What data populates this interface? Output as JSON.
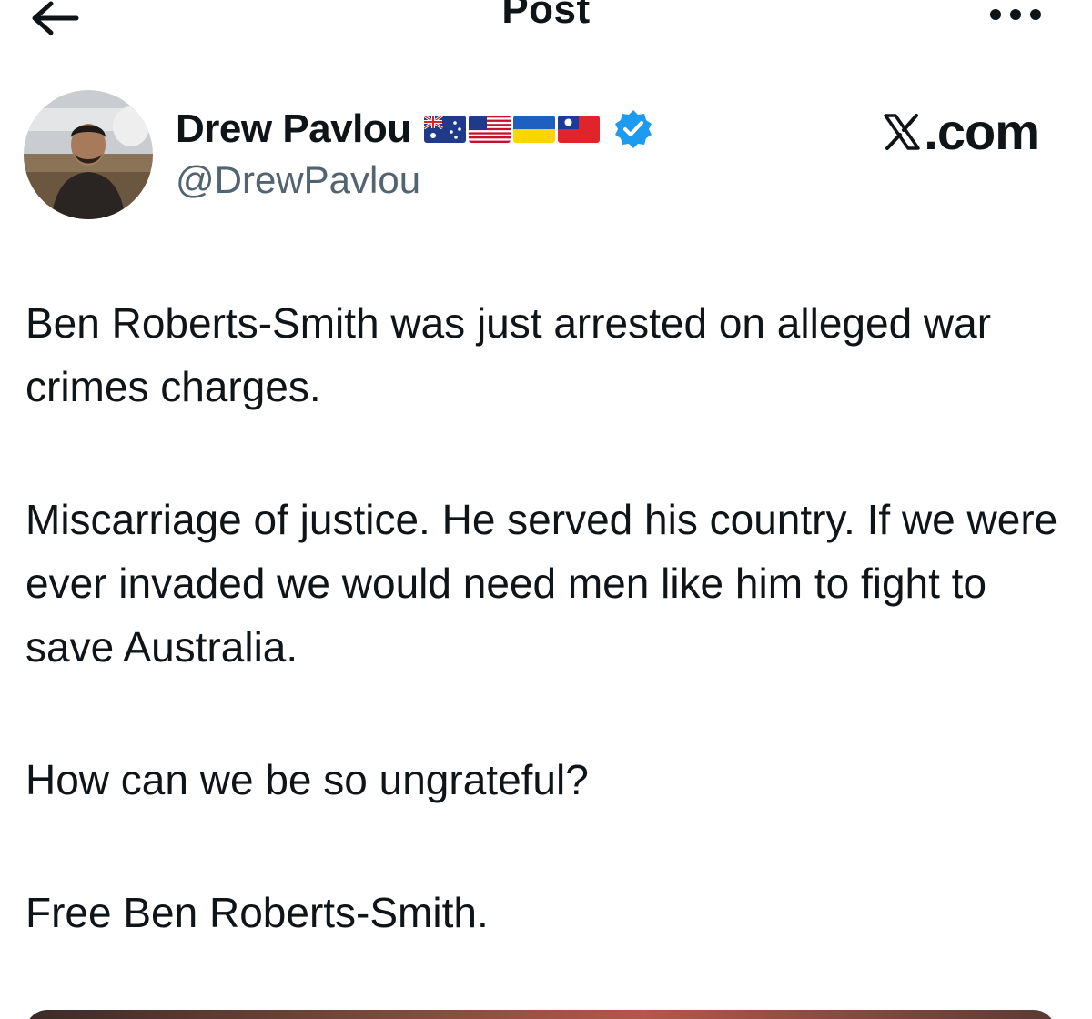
{
  "header": {
    "title": "Post"
  },
  "author": {
    "name": "Drew Pavlou",
    "handle": "@DrewPavlou",
    "flags": [
      "australia-flag",
      "usa-flag",
      "ukraine-flag",
      "taiwan-flag"
    ],
    "verified": true
  },
  "watermark": {
    "text": ".com"
  },
  "post": {
    "paragraphs": [
      "Ben Roberts-Smith was just arrested on alleged war crimes charges.",
      "Miscarriage of justice. He served his country. If we were ever invaded we would need men like him to fight to save Australia.",
      "How can we be so ungrateful?",
      "Free Ben Roberts-Smith."
    ]
  },
  "colors": {
    "text": "#0f1419",
    "secondary": "#536471",
    "verified_blue": "#1d9bf0"
  }
}
